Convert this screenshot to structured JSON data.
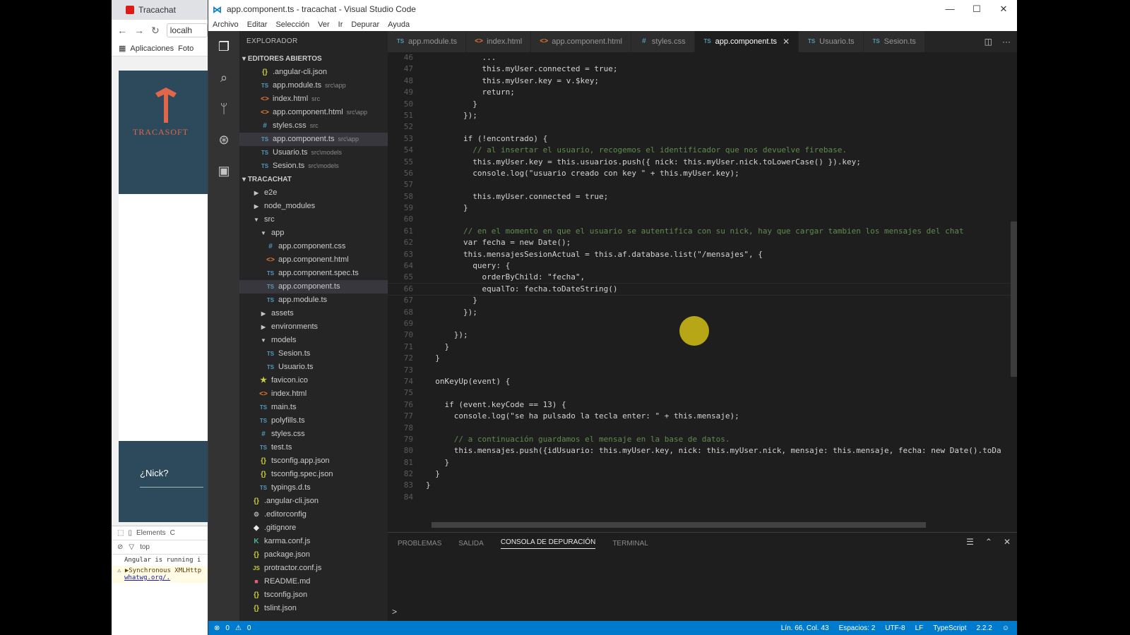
{
  "chrome": {
    "tab_title": "Tracachat",
    "url": "localh",
    "bookmarks": [
      "Aplicaciones",
      "Foto"
    ],
    "app_logo_text": "TRACASOFT",
    "nick_placeholder": "¿Nick?",
    "devtools_tabs": [
      "Elements",
      "C"
    ],
    "devtools_context": "top",
    "console_lines": [
      "Angular is running i"
    ],
    "warning": "▶Synchronous XMLHttp",
    "warning_link": "whatwg.org/."
  },
  "window": {
    "title": "app.component.ts - tracachat - Visual Studio Code",
    "menu": [
      "Archivo",
      "Editar",
      "Selección",
      "Ver",
      "Ir",
      "Depurar",
      "Ayuda"
    ]
  },
  "explorer": {
    "title": "EXPLORADOR",
    "open_editors_label": "EDITORES ABIERTOS",
    "open_editors": [
      {
        "icon": "{}",
        "type": "json",
        "name": ".angular-cli.json",
        "hint": ""
      },
      {
        "icon": "TS",
        "type": "ts",
        "name": "app.module.ts",
        "hint": "src\\app"
      },
      {
        "icon": "<>",
        "type": "html",
        "name": "index.html",
        "hint": "src"
      },
      {
        "icon": "<>",
        "type": "html",
        "name": "app.component.html",
        "hint": "src\\app"
      },
      {
        "icon": "#",
        "type": "css",
        "name": "styles.css",
        "hint": "src"
      },
      {
        "icon": "TS",
        "type": "ts",
        "name": "app.component.ts",
        "hint": "src\\app"
      },
      {
        "icon": "TS",
        "type": "ts",
        "name": "Usuario.ts",
        "hint": "src\\models"
      },
      {
        "icon": "TS",
        "type": "ts",
        "name": "Sesion.ts",
        "hint": "src\\models"
      }
    ],
    "project_label": "TRACACHAT",
    "tree": [
      {
        "icon": "▶",
        "type": "folder",
        "name": "e2e",
        "depth": 1
      },
      {
        "icon": "▶",
        "type": "folder",
        "name": "node_modules",
        "depth": 1
      },
      {
        "icon": "▼",
        "type": "folder",
        "name": "src",
        "depth": 1
      },
      {
        "icon": "▼",
        "type": "folder",
        "name": "app",
        "depth": 2
      },
      {
        "icon": "#",
        "type": "css",
        "name": "app.component.css",
        "depth": 3
      },
      {
        "icon": "<>",
        "type": "html",
        "name": "app.component.html",
        "depth": 3
      },
      {
        "icon": "TS",
        "type": "ts",
        "name": "app.component.spec.ts",
        "depth": 3
      },
      {
        "icon": "TS",
        "type": "ts",
        "name": "app.component.ts",
        "depth": 3
      },
      {
        "icon": "TS",
        "type": "ts",
        "name": "app.module.ts",
        "depth": 3
      },
      {
        "icon": "▶",
        "type": "folder",
        "name": "assets",
        "depth": 2
      },
      {
        "icon": "▶",
        "type": "folder",
        "name": "environments",
        "depth": 2
      },
      {
        "icon": "▼",
        "type": "folder",
        "name": "models",
        "depth": 2
      },
      {
        "icon": "TS",
        "type": "ts",
        "name": "Sesion.ts",
        "depth": 3
      },
      {
        "icon": "TS",
        "type": "ts",
        "name": "Usuario.ts",
        "depth": 3
      },
      {
        "icon": "★",
        "type": "star",
        "name": "favicon.ico",
        "depth": 2
      },
      {
        "icon": "<>",
        "type": "html",
        "name": "index.html",
        "depth": 2
      },
      {
        "icon": "TS",
        "type": "ts",
        "name": "main.ts",
        "depth": 2
      },
      {
        "icon": "TS",
        "type": "ts",
        "name": "polyfills.ts",
        "depth": 2
      },
      {
        "icon": "#",
        "type": "css",
        "name": "styles.css",
        "depth": 2
      },
      {
        "icon": "TS",
        "type": "ts",
        "name": "test.ts",
        "depth": 2
      },
      {
        "icon": "{}",
        "type": "json",
        "name": "tsconfig.app.json",
        "depth": 2
      },
      {
        "icon": "{}",
        "type": "json",
        "name": "tsconfig.spec.json",
        "depth": 2
      },
      {
        "icon": "TS",
        "type": "ts",
        "name": "typings.d.ts",
        "depth": 2
      },
      {
        "icon": "{}",
        "type": "json",
        "name": ".angular-cli.json",
        "depth": 1
      },
      {
        "icon": "⚙",
        "type": "cfg",
        "name": ".editorconfig",
        "depth": 1
      },
      {
        "icon": "◆",
        "type": "git",
        "name": ".gitignore",
        "depth": 1
      },
      {
        "icon": "K",
        "type": "karma",
        "name": "karma.conf.js",
        "depth": 1
      },
      {
        "icon": "{}",
        "type": "json",
        "name": "package.json",
        "depth": 1
      },
      {
        "icon": "JS",
        "type": "js",
        "name": "protractor.conf.js",
        "depth": 1
      },
      {
        "icon": "■",
        "type": "md",
        "name": "README.md",
        "depth": 1
      },
      {
        "icon": "{}",
        "type": "json",
        "name": "tsconfig.json",
        "depth": 1
      },
      {
        "icon": "{}",
        "type": "json",
        "name": "tslint.json",
        "depth": 1
      }
    ]
  },
  "tabs": [
    {
      "icon": "TS",
      "type": "ts",
      "label": "app.module.ts"
    },
    {
      "icon": "<>",
      "type": "html",
      "label": "index.html"
    },
    {
      "icon": "<>",
      "type": "html",
      "label": "app.component.html"
    },
    {
      "icon": "#",
      "type": "css",
      "label": "styles.css"
    },
    {
      "icon": "TS",
      "type": "ts",
      "label": "app.component.ts",
      "active": true
    },
    {
      "icon": "TS",
      "type": "ts",
      "label": "Usuario.ts"
    },
    {
      "icon": "TS",
      "type": "ts",
      "label": "Sesion.ts"
    }
  ],
  "code": [
    {
      "n": "46",
      "t": "            ..."
    },
    {
      "n": "47",
      "t": "            this.myUser.connected = true;"
    },
    {
      "n": "48",
      "t": "            this.myUser.key = v.$key;"
    },
    {
      "n": "49",
      "t": "            return;"
    },
    {
      "n": "50",
      "t": "          }"
    },
    {
      "n": "51",
      "t": "        });"
    },
    {
      "n": "52",
      "t": ""
    },
    {
      "n": "53",
      "t": "        if (!encontrado) {"
    },
    {
      "n": "54",
      "t": "          // al insertar el usuario, recogemos el identificador que nos devuelve firebase."
    },
    {
      "n": "55",
      "t": "          this.myUser.key = this.usuarios.push({ nick: this.myUser.nick.toLowerCase() }).key;"
    },
    {
      "n": "56",
      "t": "          console.log(\"usuario creado con key \" + this.myUser.key);"
    },
    {
      "n": "57",
      "t": ""
    },
    {
      "n": "58",
      "t": "          this.myUser.connected = true;"
    },
    {
      "n": "59",
      "t": "        }"
    },
    {
      "n": "60",
      "t": ""
    },
    {
      "n": "61",
      "t": "        // en el momento en que el usuario se autentifica con su nick, hay que cargar tambien los mensajes del chat"
    },
    {
      "n": "62",
      "t": "        var fecha = new Date();"
    },
    {
      "n": "63",
      "t": "        this.mensajesSesionActual = this.af.database.list(\"/mensajes\", {"
    },
    {
      "n": "64",
      "t": "          query: {"
    },
    {
      "n": "65",
      "t": "            orderByChild: \"fecha\","
    },
    {
      "n": "66",
      "t": "            equalTo: fecha.toDateString()"
    },
    {
      "n": "67",
      "t": "          }"
    },
    {
      "n": "68",
      "t": "        });"
    },
    {
      "n": "69",
      "t": ""
    },
    {
      "n": "70",
      "t": "      });"
    },
    {
      "n": "71",
      "t": "    }"
    },
    {
      "n": "72",
      "t": "  }"
    },
    {
      "n": "73",
      "t": ""
    },
    {
      "n": "74",
      "t": "  onKeyUp(event) {"
    },
    {
      "n": "75",
      "t": ""
    },
    {
      "n": "76",
      "t": "    if (event.keyCode == 13) {"
    },
    {
      "n": "77",
      "t": "      console.log(\"se ha pulsado la tecla enter: \" + this.mensaje);"
    },
    {
      "n": "78",
      "t": ""
    },
    {
      "n": "79",
      "t": "      // a continuación guardamos el mensaje en la base de datos."
    },
    {
      "n": "80",
      "t": "      this.mensajes.push({idUsuario: this.myUser.key, nick: this.myUser.nick, mensaje: this.mensaje, fecha: new Date().toDa"
    },
    {
      "n": "81",
      "t": "    }"
    },
    {
      "n": "82",
      "t": "  }"
    },
    {
      "n": "83",
      "t": "}"
    },
    {
      "n": "84",
      "t": ""
    }
  ],
  "panel": {
    "tabs": [
      "PROBLEMAS",
      "SALIDA",
      "CONSOLA DE DEPURACIÓN",
      "TERMINAL"
    ],
    "active_tab": "CONSOLA DE DEPURACIÓN",
    "prompt": ">"
  },
  "status": {
    "errors": "0",
    "warnings": "0",
    "position": "Lín. 66, Col. 43",
    "indent": "Espacios: 2",
    "encoding": "UTF-8",
    "eol": "LF",
    "language": "TypeScript",
    "version": "2.2.2"
  },
  "colors": {
    "accent": "#007acc",
    "editor_bg": "#1e1e1e",
    "sidebar_bg": "#252526"
  }
}
